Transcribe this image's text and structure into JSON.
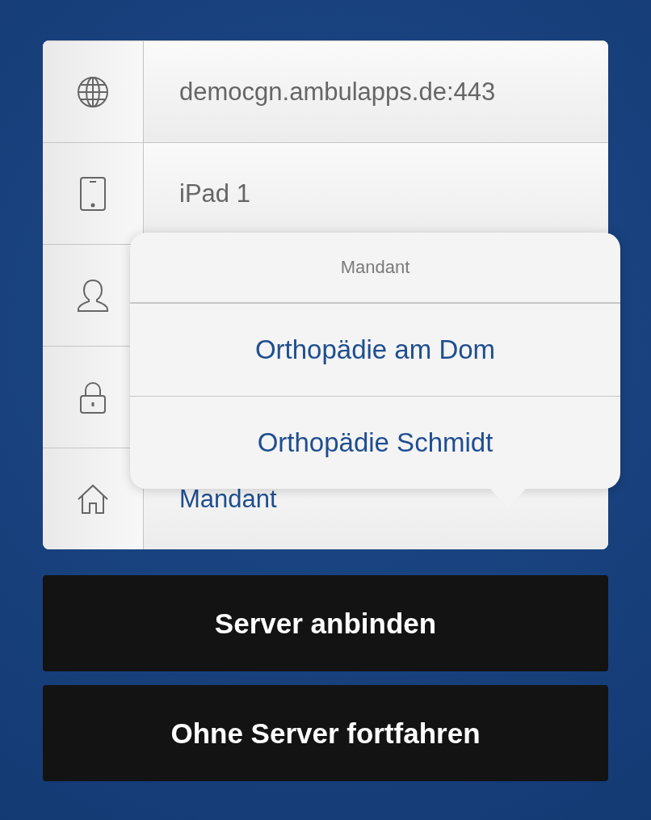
{
  "form": {
    "fields": [
      {
        "kind": "server",
        "value": "democgn.ambulapps.de:443"
      },
      {
        "kind": "device",
        "value": "iPad 1"
      },
      {
        "kind": "user"
      },
      {
        "kind": "password"
      },
      {
        "kind": "picker",
        "value": "Mandant"
      }
    ]
  },
  "popover": {
    "title": "Mandant",
    "options": [
      {
        "label": "Orthopädie am Dom"
      },
      {
        "label": "Orthopädie Schmidt"
      }
    ]
  },
  "buttons": [
    {
      "label": "Server anbinden"
    },
    {
      "label": "Ohne Server fortfahren"
    }
  ]
}
